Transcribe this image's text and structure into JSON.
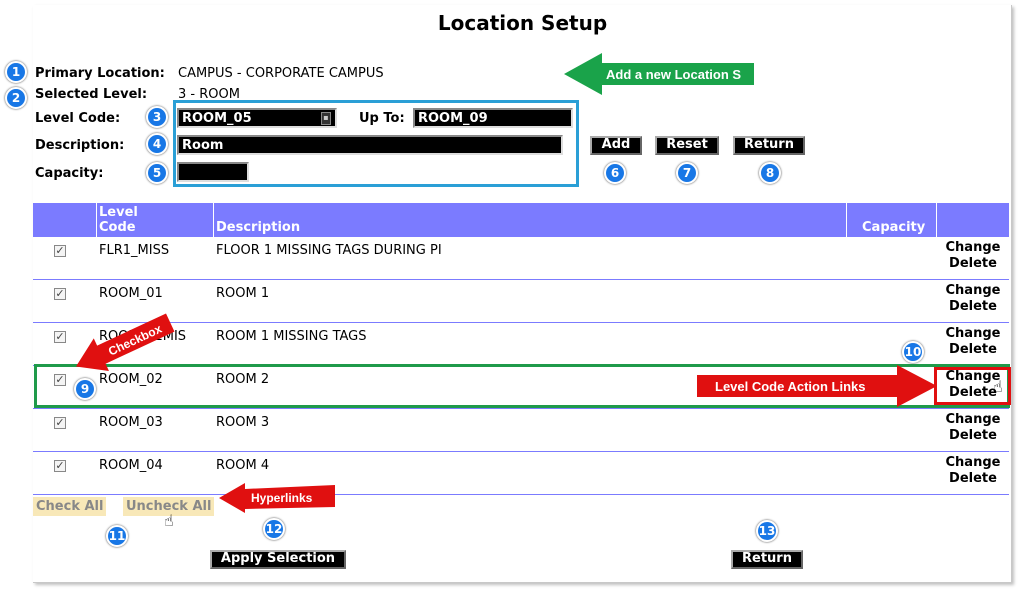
{
  "title": "Location Setup",
  "primary_location": {
    "label": "Primary Location:",
    "value": "CAMPUS - CORPORATE CAMPUS"
  },
  "selected_level": {
    "label": "Selected Level:",
    "value": "3 - ROOM"
  },
  "level_code": {
    "label": "Level Code:",
    "value": "ROOM_05",
    "upto_label": "Up To:",
    "upto_value": "ROOM_09"
  },
  "description": {
    "label": "Description:",
    "value": "Room"
  },
  "capacity": {
    "label": "Capacity:",
    "value": ""
  },
  "buttons": {
    "add": "Add",
    "reset": "Reset",
    "return": "Return",
    "apply": "Apply Selection",
    "return2": "Return"
  },
  "table": {
    "headers": {
      "level_code_1": "Level",
      "level_code_2": "Code",
      "description": "Description",
      "capacity": "Capacity"
    },
    "change_label": "Change",
    "delete_label": "Delete",
    "rows": [
      {
        "code": "FLR1_MISS",
        "description": "FLOOR 1 MISSING TAGS DURING PI"
      },
      {
        "code": "ROOM_01",
        "description": "ROOM 1"
      },
      {
        "code": "ROOM_01MIS",
        "description": "ROOM 1 MISSING TAGS"
      },
      {
        "code": "ROOM_02",
        "description": "ROOM 2"
      },
      {
        "code": "ROOM_03",
        "description": "ROOM 3"
      },
      {
        "code": "ROOM_04",
        "description": "ROOM 4"
      }
    ]
  },
  "links": {
    "check_all": "Check All",
    "uncheck_all": "Uncheck All"
  },
  "callouts": {
    "add_location": "Add a new Location S",
    "checkbox": "Checkbox",
    "level_actions": "Level Code Action Links",
    "hyperlinks": "Hyperlinks"
  },
  "badges": [
    "1",
    "2",
    "3",
    "4",
    "5",
    "6",
    "7",
    "8",
    "9",
    "10",
    "11",
    "12",
    "13"
  ],
  "colors": {
    "header": "#7b7bff",
    "badge": "#1877e6",
    "callout_red": "#e01010",
    "callout_green": "#1aa34a",
    "frame_blue": "#2a9fd6",
    "frame_green": "#1f9a4a"
  }
}
